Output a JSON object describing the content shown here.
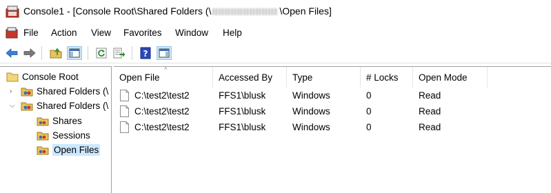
{
  "window": {
    "title_prefix": "Console1 - [Console Root\\Shared Folders (\\",
    "title_suffix": "\\Open Files]"
  },
  "menu": [
    "File",
    "Action",
    "View",
    "Favorites",
    "Window",
    "Help"
  ],
  "toolbar": {
    "buttons": [
      "back-arrow-icon",
      "forward-arrow-icon",
      "up-folder-icon",
      "show-hide-console-tree-icon",
      "refresh-icon",
      "export-list-icon",
      "help-icon",
      "show-hide-action-pane-icon"
    ]
  },
  "tree": {
    "root": "Console Root",
    "shared_folders_1": "Shared Folders (\\",
    "shared_folders_2": "Shared Folders (\\",
    "shares": "Shares",
    "sessions": "Sessions",
    "open_files": "Open Files"
  },
  "list": {
    "columns": [
      "Open File",
      "Accessed By",
      "Type",
      "# Locks",
      "Open Mode"
    ],
    "rows": [
      [
        "C:\\test2\\test2",
        "FFS1\\blusk",
        "Windows",
        "0",
        "Read"
      ],
      [
        "C:\\test2\\test2",
        "FFS1\\blusk",
        "Windows",
        "0",
        "Read"
      ],
      [
        "C:\\test2\\test2",
        "FFS1\\blusk",
        "Windows",
        "0",
        "Read"
      ]
    ]
  },
  "colors": {
    "selection": "#cce8ff",
    "toolbar_pressed": "#cce4f7",
    "divider": "#a0a0a0"
  }
}
